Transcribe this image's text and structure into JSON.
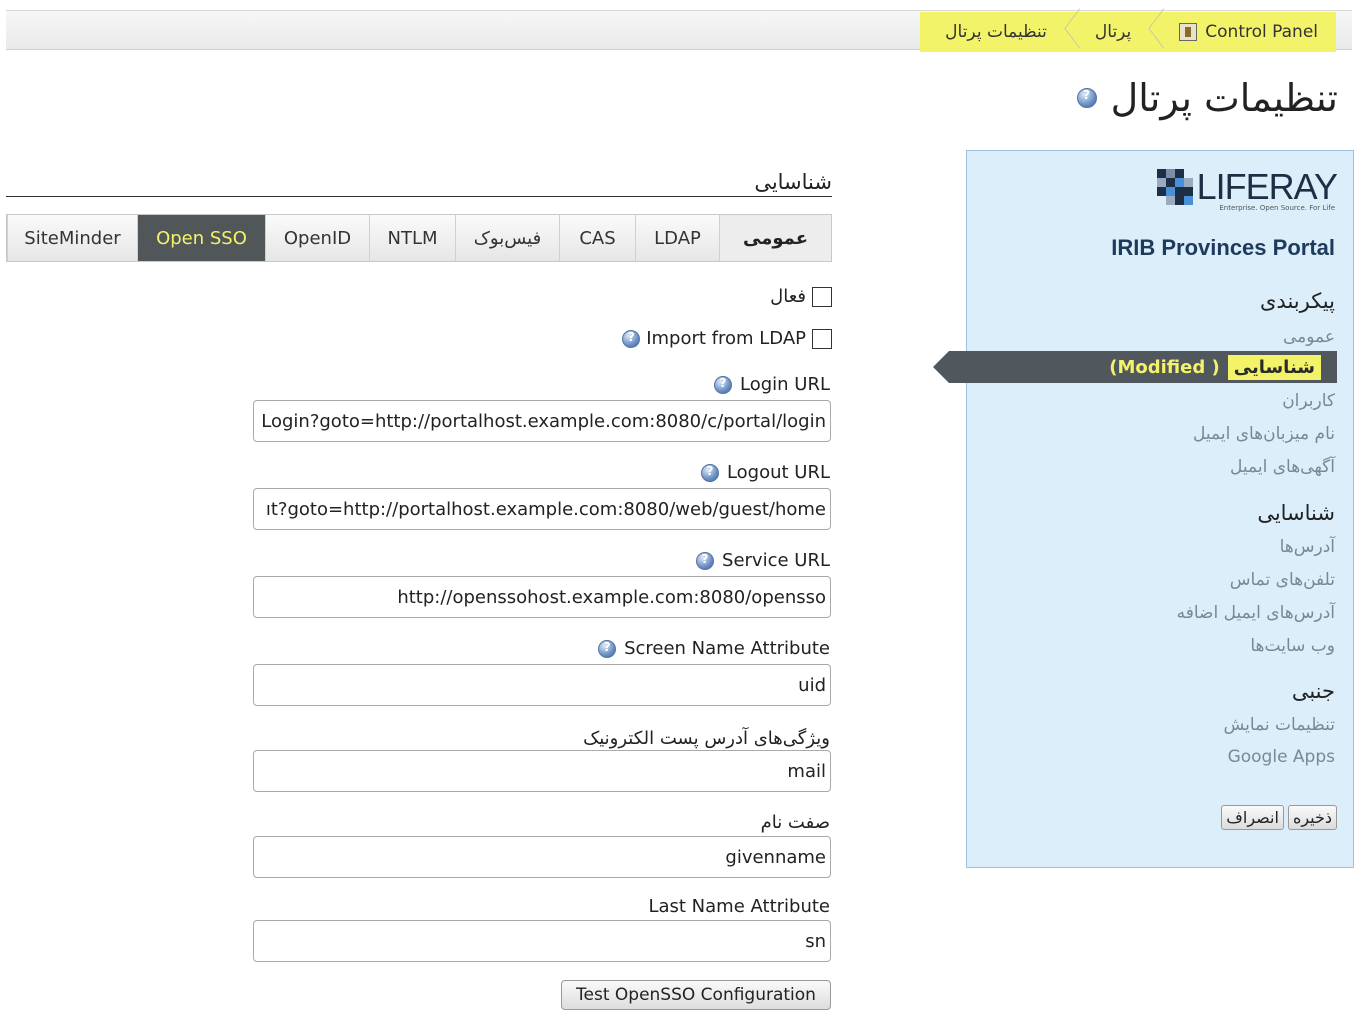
{
  "breadcrumb": {
    "items": [
      "Control Panel",
      "پرتال",
      "تنظیمات پرتال"
    ]
  },
  "page": {
    "title": "تنظیمات پرتال"
  },
  "panel": {
    "logo_text": "LIFERAY",
    "logo_sub": "Enterprise. Open Source. For Life",
    "portal_name": "IRIB Provinces Portal",
    "sections": [
      {
        "heading": "پیکربندی",
        "items": [
          "عمومی",
          "شناسایی",
          "کاربران",
          "نام میزبان‌های ایمیل",
          "آگهی‌های ایمیل"
        ]
      },
      {
        "heading": "شناسایی",
        "items": [
          "آدرس‌ها",
          "تلفن‌های تماس",
          "آدرس‌های ایمیل اضافه",
          "وب سایت‌ها"
        ]
      },
      {
        "heading": "جنبی",
        "items": [
          "تنظیمات نمایش",
          "Google Apps"
        ]
      }
    ],
    "active_label": "شناسایی",
    "active_modified": "( Modified)",
    "save_label": "ذخیره",
    "cancel_label": "انصراف"
  },
  "section": {
    "title": "شناسایی"
  },
  "tabs": [
    "عمومی",
    "LDAP",
    "CAS",
    "فیس‌بوک",
    "NTLM",
    "OpenID",
    "Open SSO",
    "SiteMinder"
  ],
  "form": {
    "enabled_label": "فعال",
    "import_ldap_label": "Import from LDAP",
    "login_url_label": "Login URL",
    "login_url_value": "Login?goto=http://portalhost.example.com:8080/c/portal/login",
    "logout_url_label": "Logout URL",
    "logout_url_value": "ıt?goto=http://portalhost.example.com:8080/web/guest/home",
    "service_url_label": "Service URL",
    "service_url_value": "http://openssohost.example.com:8080/opensso",
    "screen_name_label": "Screen Name Attribute",
    "screen_name_value": "uid",
    "email_label": "ویژگی‌های آدرس پست الکترونیک",
    "email_value": "mail",
    "first_name_label": "صفت نام",
    "first_name_value": "givenname",
    "last_name_label": "Last Name Attribute",
    "last_name_value": "sn",
    "test_button": "Test OpenSSO Configuration"
  },
  "colors": {
    "highlight": "#f3f36a",
    "panel_bg": "#dbeefa",
    "active_bg": "#50575d"
  }
}
